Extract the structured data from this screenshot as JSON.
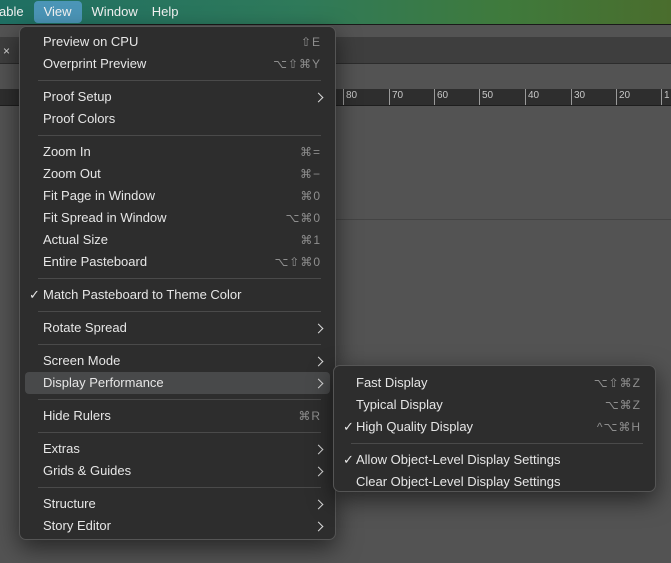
{
  "menubar": {
    "items": [
      "able",
      "View",
      "Window",
      "Help"
    ],
    "active": "View"
  },
  "tab": {
    "close_glyph": "×"
  },
  "ruler": {
    "labels": [
      "80",
      "70",
      "60",
      "50",
      "40",
      "30",
      "20",
      "1"
    ]
  },
  "view_menu": {
    "preview_cpu": {
      "label": "Preview on CPU",
      "shortcut": "⇧E"
    },
    "overprint": {
      "label": "Overprint Preview",
      "shortcut": "⌥⇧⌘Y"
    },
    "proof_setup": {
      "label": "Proof Setup"
    },
    "proof_colors": {
      "label": "Proof Colors"
    },
    "zoom_in": {
      "label": "Zoom In",
      "shortcut": "⌘="
    },
    "zoom_out": {
      "label": "Zoom Out",
      "shortcut": "⌘−"
    },
    "fit_page": {
      "label": "Fit Page in Window",
      "shortcut": "⌘0"
    },
    "fit_spread": {
      "label": "Fit Spread in Window",
      "shortcut": "⌥⌘0"
    },
    "actual_size": {
      "label": "Actual Size",
      "shortcut": "⌘1"
    },
    "entire_pasteboard": {
      "label": "Entire Pasteboard",
      "shortcut": "⌥⇧⌘0"
    },
    "match_pasteboard": {
      "label": "Match Pasteboard to Theme Color",
      "checked": true
    },
    "rotate_spread": {
      "label": "Rotate Spread"
    },
    "screen_mode": {
      "label": "Screen Mode"
    },
    "display_performance": {
      "label": "Display Performance"
    },
    "hide_rulers": {
      "label": "Hide Rulers",
      "shortcut": "⌘R"
    },
    "extras": {
      "label": "Extras"
    },
    "grids_guides": {
      "label": "Grids & Guides"
    },
    "structure": {
      "label": "Structure"
    },
    "story_editor": {
      "label": "Story Editor"
    }
  },
  "display_submenu": {
    "fast": {
      "label": "Fast Display",
      "shortcut": "⌥⇧⌘Z"
    },
    "typical": {
      "label": "Typical Display",
      "shortcut": "⌥⌘Z"
    },
    "high_quality": {
      "label": "High Quality Display",
      "shortcut": "^⌥⌘H",
      "checked": true
    },
    "allow_object": {
      "label": "Allow Object-Level Display Settings",
      "checked": true
    },
    "clear_object": {
      "label": "Clear Object-Level Display Settings"
    }
  },
  "check_glyph": "✓",
  "colors": {
    "menubar_highlight": "#4b95b7",
    "menu_bg": "#2d2d2d",
    "item_highlight": "#48494a"
  }
}
